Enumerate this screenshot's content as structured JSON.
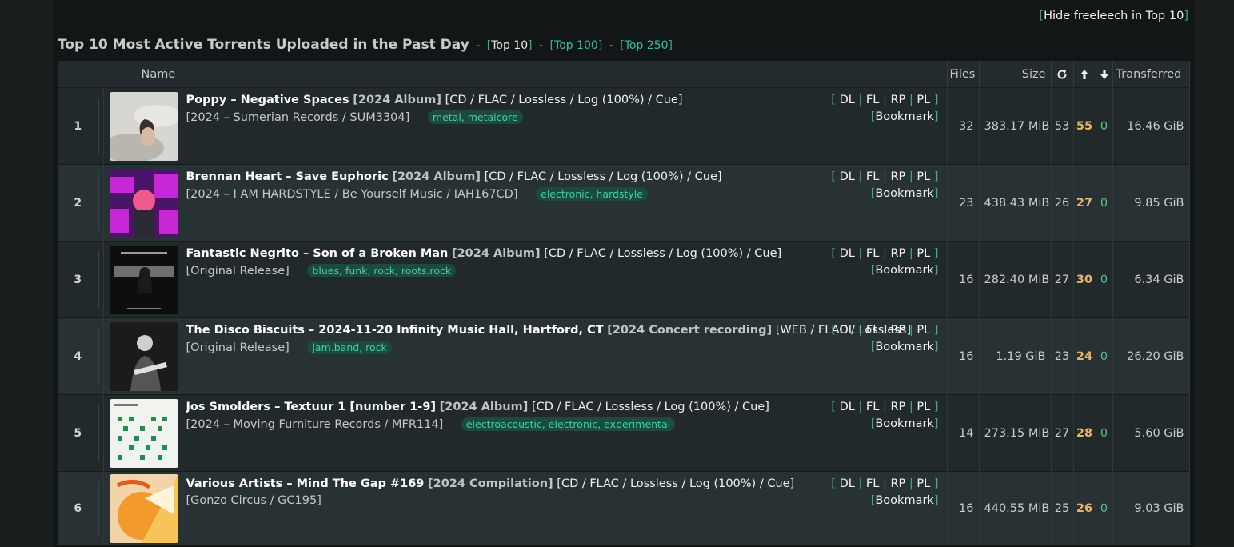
{
  "hide_link": "Hide freeleech in Top 10",
  "heading": {
    "title": "Top 10 Most Active Torrents Uploaded in the Past Day",
    "links": [
      "Top 10",
      "Top 100",
      "Top 250"
    ]
  },
  "columns": {
    "name": "Name",
    "files": "Files",
    "size": "Size",
    "snatched_icon": "refresh-icon",
    "seeders_icon": "arrow-up-icon",
    "leechers_icon": "arrow-down-icon",
    "transferred": "Transferred"
  },
  "actions": {
    "dl": "DL",
    "fl": "FL",
    "rp": "RP",
    "pl": "PL",
    "bookmark": "Bookmark"
  },
  "colors": {
    "accent": "#2fc39b",
    "seeders": "#e6b46a",
    "leechers": "#5cc283",
    "tag_bg": "#1c4a3e"
  },
  "rows": [
    {
      "rank": "1",
      "artist_title": "Poppy – Negative Spaces",
      "release": "[2024 Album]",
      "format": "[CD / FLAC / Lossless / Log (100%) / Cue]",
      "label": "[2024 – Sumerian Records / SUM3304]",
      "tags": "metal, metalcore",
      "files": "32",
      "size": "383.17 MiB",
      "snatched": "53",
      "seeders": "55",
      "leechers": "0",
      "transferred": "16.46 GiB"
    },
    {
      "rank": "2",
      "artist_title": "Brennan Heart – Save Euphoric",
      "release": "[2024 Album]",
      "format": "[CD / FLAC / Lossless / Log (100%) / Cue]",
      "label": "[2024 – I AM HARDSTYLE / Be Yourself Music / IAH167CD]",
      "tags": "electronic, hardstyle",
      "files": "23",
      "size": "438.43 MiB",
      "snatched": "26",
      "seeders": "27",
      "leechers": "0",
      "transferred": "9.85 GiB"
    },
    {
      "rank": "3",
      "artist_title": "Fantastic Negrito – Son of a Broken Man",
      "release": "[2024 Album]",
      "format": "[CD / FLAC / Lossless / Log (100%) / Cue]",
      "label": "[Original Release]",
      "tags": "blues, funk, rock, roots.rock",
      "files": "16",
      "size": "282.40 MiB",
      "snatched": "27",
      "seeders": "30",
      "leechers": "0",
      "transferred": "6.34 GiB"
    },
    {
      "rank": "4",
      "artist_title": "The Disco Biscuits – 2024-11-20 Infinity Music Hall, Hartford, CT",
      "release": "[2024 Concert recording]",
      "format": "[WEB / FLAC / Lossless]",
      "label": "[Original Release]",
      "tags": "jam.band, rock",
      "files": "16",
      "size": "1.19 GiB",
      "snatched": "23",
      "seeders": "24",
      "leechers": "0",
      "transferred": "26.20 GiB"
    },
    {
      "rank": "5",
      "artist_title": "Jos Smolders – Textuur 1 [number 1-9]",
      "release": "[2024 Album]",
      "format": "[CD / FLAC / Lossless / Log (100%) / Cue]",
      "label": "[2024 – Moving Furniture Records / MFR114]",
      "tags": "electroacoustic, electronic, experimental",
      "files": "14",
      "size": "273.15 MiB",
      "snatched": "27",
      "seeders": "28",
      "leechers": "0",
      "transferred": "5.60 GiB"
    },
    {
      "rank": "6",
      "artist_title": "Various Artists – Mind The Gap #169",
      "release": "[2024 Compilation]",
      "format": "[CD / FLAC / Lossless / Log (100%) / Cue]",
      "label": "[Gonzo Circus / GC195]",
      "tags": "",
      "files": "16",
      "size": "440.55 MiB",
      "snatched": "25",
      "seeders": "26",
      "leechers": "0",
      "transferred": "9.03 GiB"
    }
  ]
}
